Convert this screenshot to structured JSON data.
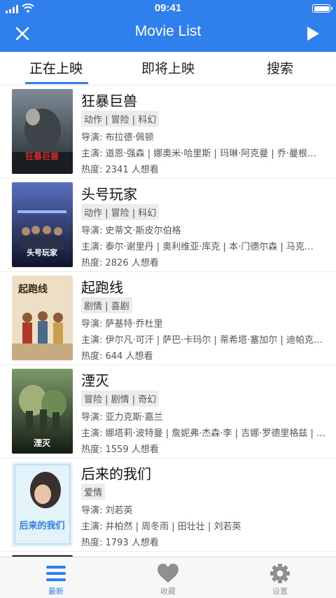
{
  "status_bar": {
    "time": "09:41"
  },
  "nav": {
    "title": "Movie List",
    "left_icon": "close-icon",
    "right_icon": "play-icon"
  },
  "tabs": [
    {
      "label": "正在上映",
      "active": true
    },
    {
      "label": "即将上映",
      "active": false
    },
    {
      "label": "搜索",
      "active": false
    }
  ],
  "movies": [
    {
      "title": "狂暴巨兽",
      "genres": "动作 | 冒险 | 科幻",
      "director": "导演: 布拉德·佩顿",
      "cast": "主演: 道恩·强森 | 娜奥米·哈里斯 | 玛琳·阿克曼 | 乔·曼根…",
      "heat": "热度: 2341 人想看",
      "poster_text": "狂暴巨兽",
      "poster_colors": [
        "#6d7a85",
        "#2b3036"
      ]
    },
    {
      "title": "头号玩家",
      "genres": "动作 | 冒险 | 科幻",
      "director": "导演: 史蒂文·斯皮尔伯格",
      "cast": "主演: 泰尔·谢里丹 | 奥利维亚·库克 | 本·门德尔森 | 马克…",
      "heat": "热度: 2826 人想看",
      "poster_text": "头号玩家",
      "poster_colors": [
        "#3a4a8a",
        "#141a33"
      ]
    },
    {
      "title": "起跑线",
      "genres": "剧情 | 喜剧",
      "director": "导演: 萨基特·乔杜里",
      "cast": "主演: 伊尔凡·可汗 | 萨巴·卡玛尔 | 蒂希塔·塞加尔 | 迪帕克…",
      "heat": "热度: 644 人想看",
      "poster_text": "起跑线",
      "poster_colors": [
        "#e9dcc4",
        "#b99c72"
      ]
    },
    {
      "title": "湮灭",
      "genres": "冒险 | 剧情 | 奇幻",
      "director": "导演: 亚力克斯·嘉兰",
      "cast": "主演: 娜塔莉·波特曼 | 詹妮弗·杰森·李 | 吉娜·罗德里格兹 | …",
      "heat": "热度: 1559 人想看",
      "poster_text": "湮灭",
      "poster_colors": [
        "#4e6b4a",
        "#1f2a1e"
      ]
    },
    {
      "title": "后来的我们",
      "genres": "爱情",
      "director": "导演: 刘若英",
      "cast": "主演: 井柏然 | 周冬雨 | 田壮壮 | 刘若英",
      "heat": "热度: 1793 人想看",
      "poster_text": "后来的我们",
      "poster_colors": [
        "#d9ecf7",
        "#8fc3e4"
      ]
    }
  ],
  "tabbar": [
    {
      "label": "最新",
      "icon": "list-icon",
      "active": true
    },
    {
      "label": "收藏",
      "icon": "heart-icon",
      "active": false
    },
    {
      "label": "设置",
      "icon": "gear-icon",
      "active": false
    }
  ],
  "colors": {
    "accent": "#2f80ed",
    "inactive": "#999999"
  }
}
